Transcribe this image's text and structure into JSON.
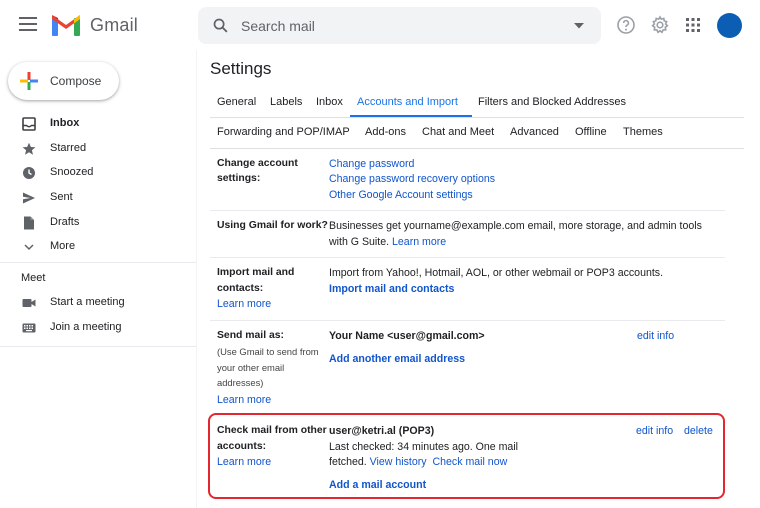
{
  "header": {
    "brand": "Gmail",
    "search_placeholder": "Search mail"
  },
  "sidebar": {
    "compose_label": "Compose",
    "items": [
      {
        "label": "Inbox",
        "icon": "inbox-icon"
      },
      {
        "label": "Starred",
        "icon": "star-icon"
      },
      {
        "label": "Snoozed",
        "icon": "clock-icon"
      },
      {
        "label": "Sent",
        "icon": "send-icon"
      },
      {
        "label": "Drafts",
        "icon": "draft-icon"
      },
      {
        "label": "More",
        "icon": "chevron-down-icon"
      }
    ],
    "meet": {
      "title": "Meet",
      "items": [
        {
          "label": "Start a meeting",
          "icon": "video-icon"
        },
        {
          "label": "Join a meeting",
          "icon": "keyboard-icon"
        }
      ]
    }
  },
  "settings": {
    "title": "Settings",
    "tabs_row1": [
      "General",
      "Labels",
      "Inbox",
      "Accounts and Import",
      "Filters and Blocked Addresses"
    ],
    "tabs_row2": [
      "Forwarding and POP/IMAP",
      "Add-ons",
      "Chat and Meet",
      "Advanced",
      "Offline",
      "Themes"
    ],
    "active_tab": "Accounts and Import",
    "rows": {
      "change_account": {
        "label_line1": "Change account",
        "label_line2": "settings:",
        "links": [
          "Change password",
          "Change password recovery options",
          "Other Google Account settings"
        ]
      },
      "gmail_for_work": {
        "label": "Using Gmail for work?",
        "text_line1": "Businesses get yourname@example.com email, more storage, and admin tools",
        "text_line2": "with G Suite.",
        "link": "Learn more"
      },
      "import_mail": {
        "label_line1": "Import mail and",
        "label_line2": "contacts:",
        "learn_more": "Learn more",
        "text": "Import from Yahoo!, Hotmail, AOL, or other webmail or POP3 accounts.",
        "action": "Import mail and contacts"
      },
      "send_mail_as": {
        "label": "Send mail as:",
        "sub_line1": "(Use Gmail to send from",
        "sub_line2": "your other email",
        "sub_line3": "addresses)",
        "learn_more": "Learn more",
        "identity": "Your Name <user@gmail.com>",
        "edit": "edit info",
        "add": "Add another email address"
      },
      "check_mail": {
        "label_line1": "Check mail from other",
        "label_line2": "accounts:",
        "learn_more": "Learn more",
        "account": "user@ketri.al (POP3)",
        "status_line1": "Last checked: 34 minutes ago. One mail",
        "status_line2": "fetched.",
        "view_history": "View history",
        "check_now": "Check mail now",
        "edit": "edit info",
        "delete": "delete",
        "add": "Add a mail account"
      }
    }
  },
  "colors": {
    "link": "#1155cc",
    "accent": "#1a73e8",
    "highlight": "#e3262f",
    "avatar": "#0b5eb4"
  }
}
